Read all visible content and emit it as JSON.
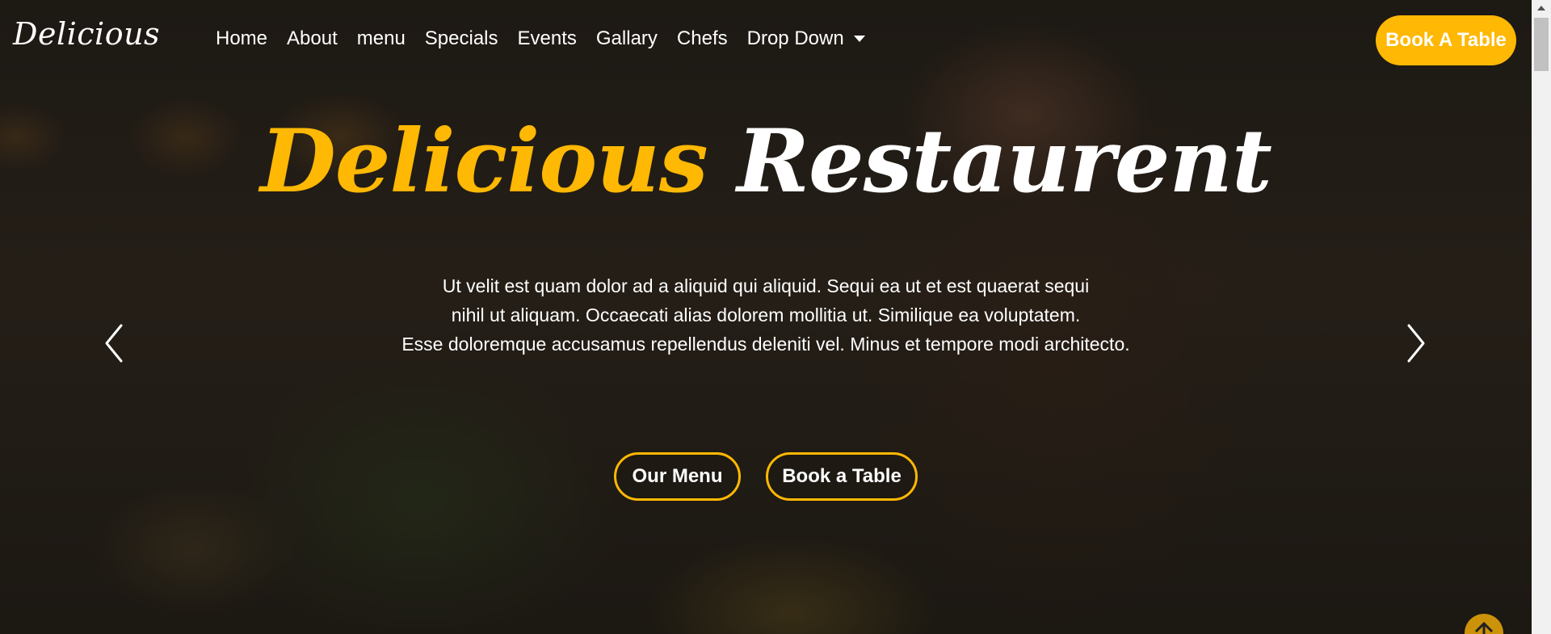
{
  "header": {
    "logo": "Delicious",
    "nav": [
      {
        "label": "Home"
      },
      {
        "label": "About"
      },
      {
        "label": "menu"
      },
      {
        "label": "Specials"
      },
      {
        "label": "Events"
      },
      {
        "label": "Gallary"
      },
      {
        "label": "Chefs"
      },
      {
        "label": "Drop Down"
      }
    ],
    "cta": "Book A Table"
  },
  "hero": {
    "title_part1": "Delicious",
    "title_part2": "Restaurent",
    "text_lines": [
      "Ut velit est quam dolor ad a aliquid qui aliquid. Sequi ea ut et est quaerat sequi",
      "nihil ut aliquam. Occaecati alias dolorem mollitia ut. Similique ea voluptatem.",
      "Esse doloremque accusamus repellendus deleniti vel. Minus et tempore modi architecto."
    ],
    "buttons": {
      "menu": "Our Menu",
      "book": "Book a Table"
    }
  },
  "icons": {
    "prev": "chevron-left-icon",
    "next": "chevron-right-icon",
    "dropdown": "caret-down-icon",
    "scroll_top": "arrow-up-icon"
  },
  "colors": {
    "accent": "#ffb803",
    "text": "#ffffff",
    "scroll_top_bg": "#cc930a"
  }
}
